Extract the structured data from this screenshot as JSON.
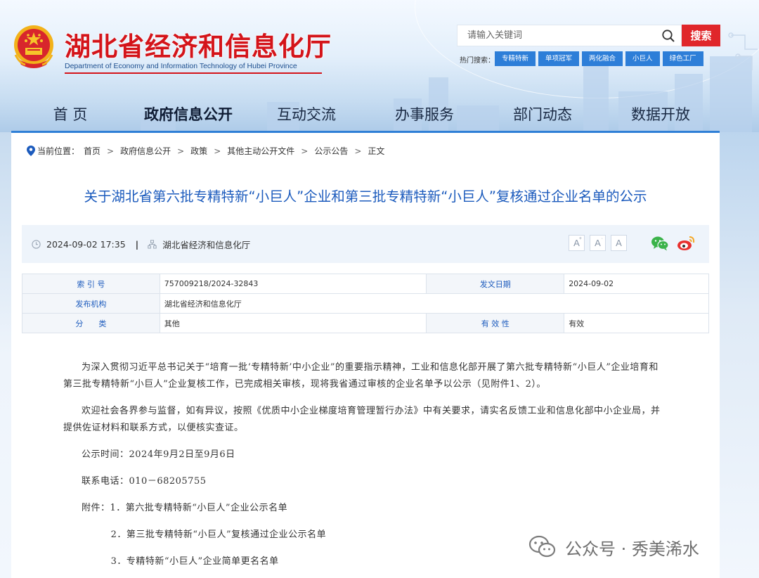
{
  "header": {
    "site_title": "湖北省经济和信息化厅",
    "site_subtitle": "Department of Economy and Information Technology of Hubei Province",
    "emblem_icon": "national-emblem-icon",
    "brand_red": "#d4141a",
    "accent_blue": "#2f7fd6"
  },
  "search": {
    "placeholder": "请输入关键词",
    "button_label": "搜索",
    "hot_label": "热门搜索：",
    "hot_tags": [
      "专精特新",
      "单项冠军",
      "两化融合",
      "小巨人",
      "绿色工厂"
    ]
  },
  "nav": {
    "items": [
      "首 页",
      "政府信息公开",
      "互动交流",
      "办事服务",
      "部门动态",
      "数据开放"
    ],
    "active": "政府信息公开"
  },
  "breadcrumb": {
    "label": "当前位置：",
    "items": [
      "首页",
      "政府信息公开",
      "政策",
      "其他主动公开文件",
      "公示公告",
      "正文"
    ],
    "separator": ">"
  },
  "article": {
    "title": "关于湖北省第六批专精特新“小巨人”企业和第三批专精特新“小巨人”复核通过企业名单的公示",
    "datetime": "2024-09-02 17:35",
    "divider": "|",
    "publisher": "湖北省经济和信息化厅",
    "font_sizes": [
      "A+",
      "A",
      "A"
    ],
    "share_icons": [
      "wechat-icon",
      "weibo-icon"
    ]
  },
  "info_table": {
    "index_label": "索 引 号",
    "index_value": "757009218/2024-32843",
    "date_label": "发文日期",
    "date_value": "2024-09-02",
    "org_label": "发布机构",
    "org_value": "湖北省经济和信息化厅",
    "category_label": "分　　类",
    "category_value": "其他",
    "validity_label": "有 效 性",
    "validity_value": "有效"
  },
  "body": {
    "p1": "为深入贯彻习近平总书记关于“培育一批‘专精特新’中小企业”的重要指示精神，工业和信息化部开展了第六批专精特新“小巨人”企业培育和第三批专精特新“小巨人”企业复核工作，已完成相关审核，现将我省通过审核的企业名单予以公示（见附件1、2）。",
    "p2": "欢迎社会各界参与监督，如有异议，按照《优质中小企业梯度培育管理暂行办法》中有关要求，请实名反馈工业和信息化部中小企业局，并提供佐证材料和联系方式，以便核实查证。",
    "period": "公示时间：2024年9月2日至9月6日",
    "phone": "联系电话：010－68205755",
    "attach1": "附件：1．第六批专精特新“小巨人”企业公示名单",
    "attach2": "2．第三批专精特新“小巨人”复核通过企业公示名单",
    "attach3": "3．专精特新“小巨人”企业简单更名名单"
  },
  "watermark": {
    "text": "公众号 · 秀美浠水",
    "icon": "wechat-official-account-icon"
  }
}
